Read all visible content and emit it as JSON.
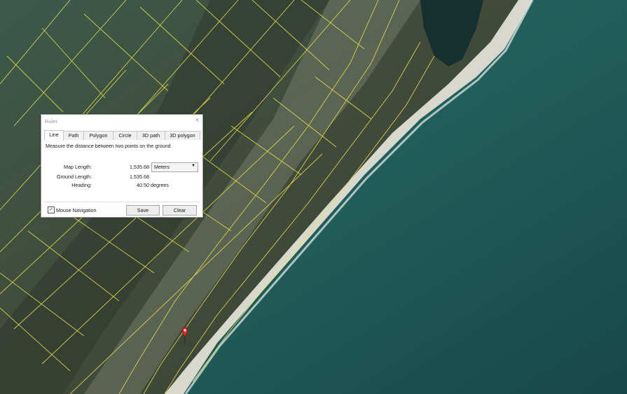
{
  "colors": {
    "ocean": "#1f5a57",
    "land": "#3f4a3a",
    "parcel_lines": "#e8e84a"
  },
  "map": {
    "marker_icon": "map-pin-icon"
  },
  "ruler": {
    "title": "Ruler",
    "close_icon": "close-icon",
    "tabs": [
      "Line",
      "Path",
      "Polygon",
      "Circle",
      "3D path",
      "3D polygon"
    ],
    "active_tab": "Line",
    "description": "Measure the distance between two points on the ground",
    "map_length_label": "Map Length:",
    "map_length_value": "1,535.68",
    "unit": "Meters",
    "ground_length_label": "Ground Length:",
    "ground_length_value": "1,535.68",
    "heading_label": "Heading:",
    "heading_value": "40.50 degrees",
    "mouse_navigation_label": "Mouse Navigation",
    "mouse_navigation_checked": true,
    "save_label": "Save",
    "clear_label": "Clear"
  }
}
